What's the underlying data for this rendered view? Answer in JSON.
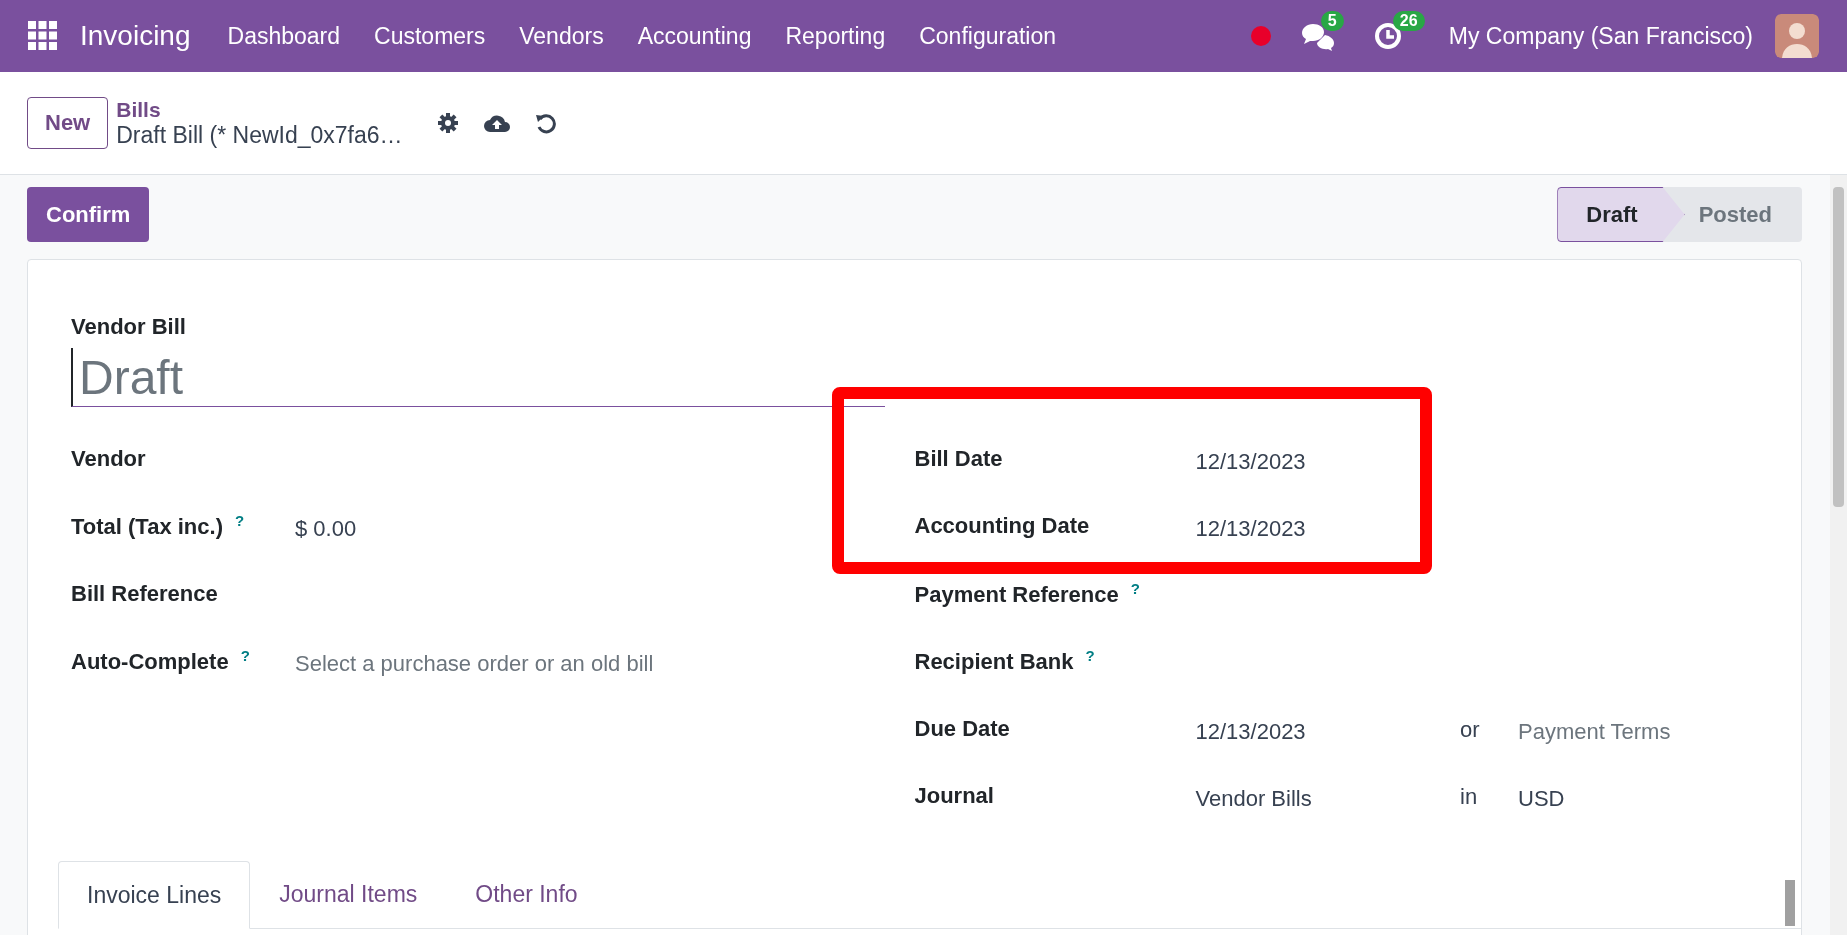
{
  "navbar": {
    "app_name": "Invoicing",
    "menu": [
      "Dashboard",
      "Customers",
      "Vendors",
      "Accounting",
      "Reporting",
      "Configuration"
    ],
    "messages_count": "5",
    "activities_count": "26",
    "company": "My Company (San Francisco)"
  },
  "breadcrumb": {
    "parent": "Bills",
    "current": "Draft Bill (* NewId_0x7fa6…"
  },
  "new_button": "New",
  "confirm_button": "Confirm",
  "status_steps": [
    {
      "label": "Draft",
      "selected": true
    },
    {
      "label": "Posted",
      "selected": false
    }
  ],
  "document": {
    "type_label": "Vendor Bill",
    "name_placeholder": "Draft"
  },
  "left_fields": [
    {
      "label": "Vendor"
    },
    {
      "label": "Total (Tax inc.)",
      "help": "?",
      "value": "$ 0.00"
    },
    {
      "label": "Bill Reference"
    },
    {
      "label": "Auto-Complete",
      "help": "?",
      "placeholder": "Select a purchase order or an old bill"
    }
  ],
  "right_column": {
    "highlighted_fields": [
      {
        "label": "Bill Date",
        "value": "12/13/2023"
      },
      {
        "label": "Accounting Date",
        "value": "12/13/2023"
      }
    ],
    "fields": [
      {
        "label": "Payment Reference",
        "help": "?"
      },
      {
        "label": "Recipient Bank",
        "help": "?"
      },
      {
        "label": "Due Date",
        "value": "12/13/2023",
        "connector": "or",
        "extra_placeholder": "Payment Terms"
      },
      {
        "label": "Journal",
        "value": "Vendor Bills",
        "connector": "in",
        "extra_value": "USD"
      }
    ]
  },
  "tabs": [
    {
      "label": "Invoice Lines",
      "selected": true
    },
    {
      "label": "Journal Items",
      "selected": false
    },
    {
      "label": "Other Info",
      "selected": false
    }
  ]
}
